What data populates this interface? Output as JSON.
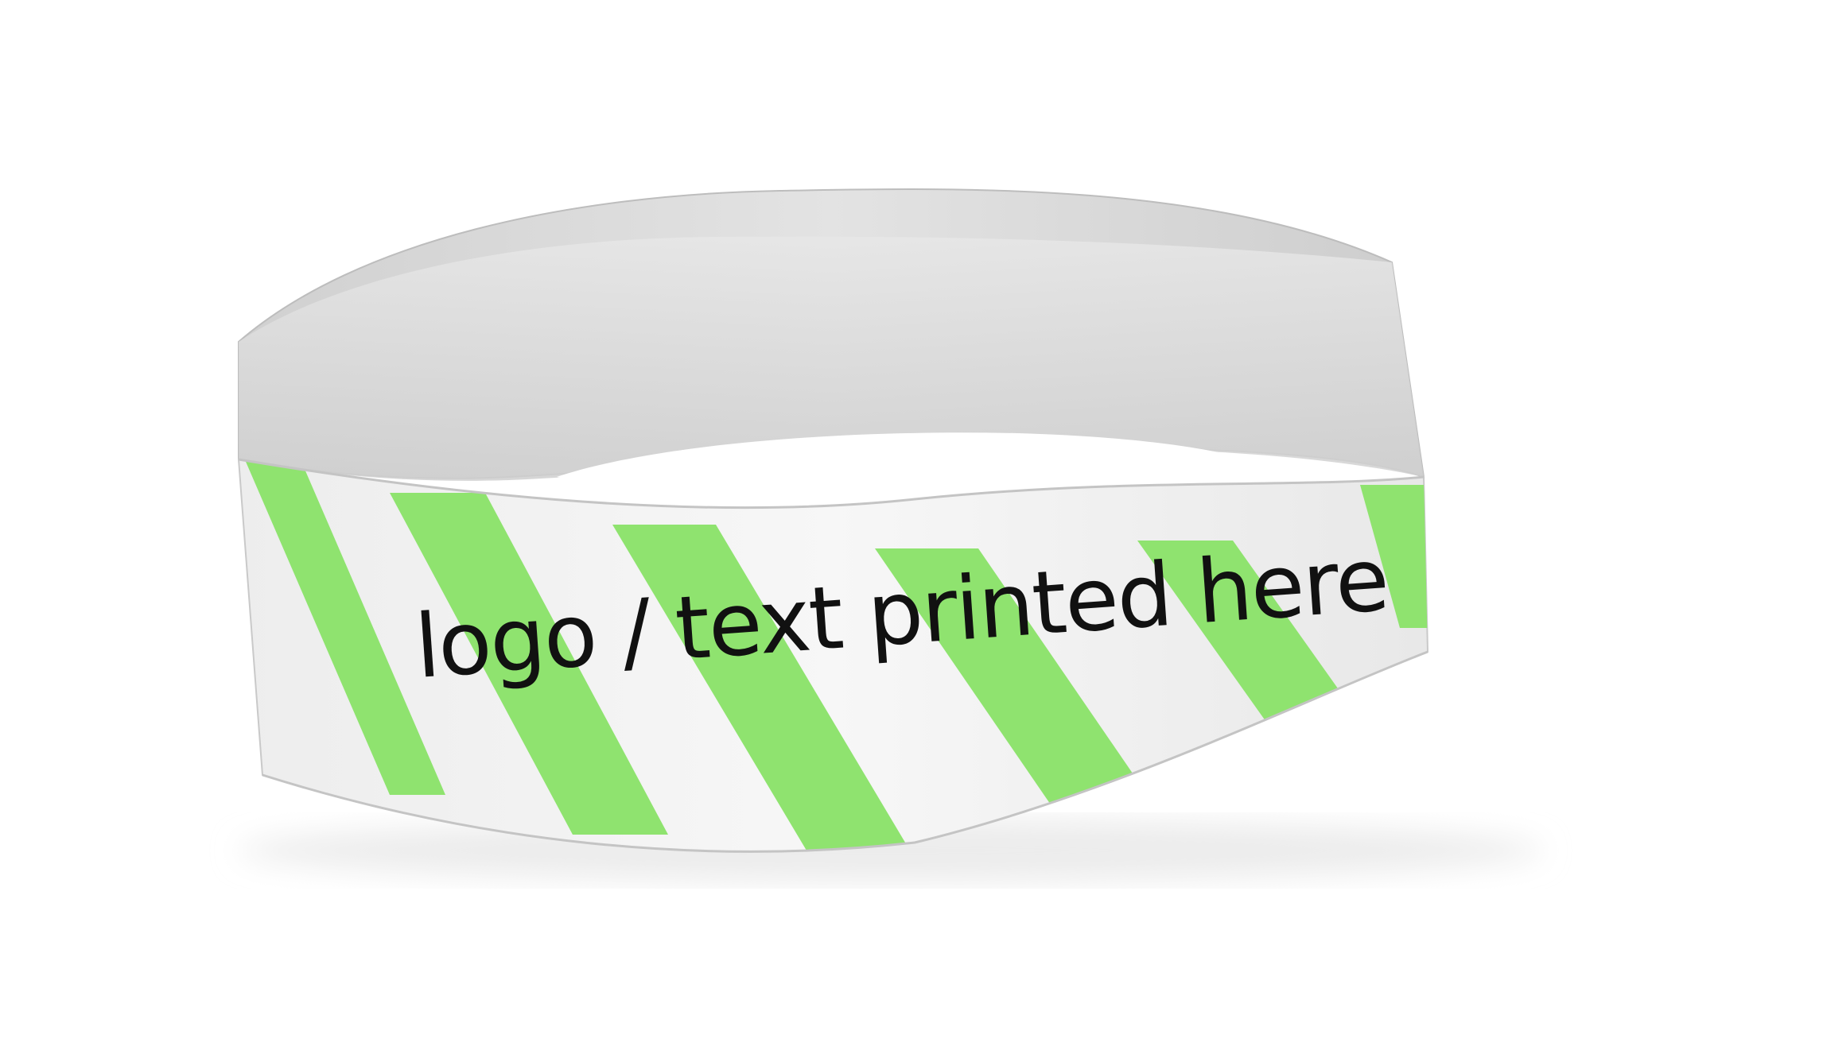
{
  "wristband": {
    "printed_text": "logo / text printed here",
    "colors": {
      "band_outer": "#f1f1f1",
      "band_inner": "#d9d9d9",
      "stripe": "#8fe36f",
      "stripe_dark": "#7fd45f",
      "text": "#111111",
      "background": "#ffffff"
    }
  }
}
